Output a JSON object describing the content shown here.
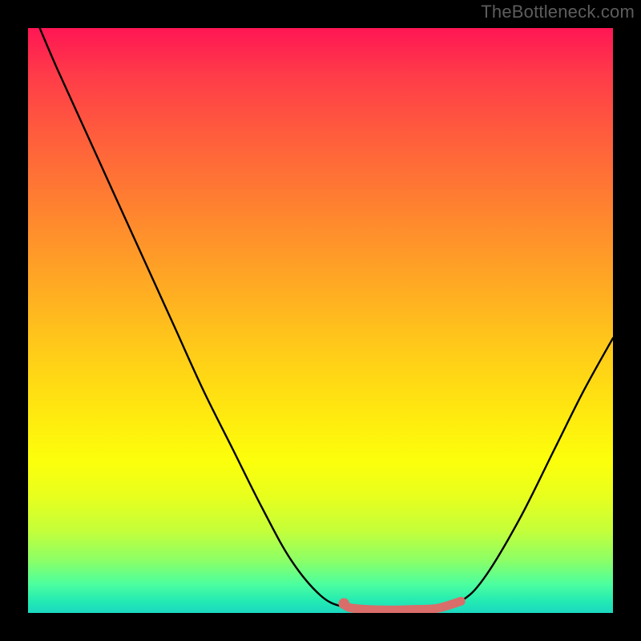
{
  "watermark": "TheBottleneck.com",
  "chart_data": {
    "type": "line",
    "title": "",
    "xlabel": "",
    "ylabel": "",
    "xlim": [
      0,
      100
    ],
    "ylim": [
      0,
      100
    ],
    "series": [
      {
        "name": "curve",
        "color": "#000000",
        "points": [
          {
            "x": 2,
            "y": 100
          },
          {
            "x": 5,
            "y": 93
          },
          {
            "x": 10,
            "y": 82
          },
          {
            "x": 15,
            "y": 71
          },
          {
            "x": 20,
            "y": 60
          },
          {
            "x": 25,
            "y": 49
          },
          {
            "x": 30,
            "y": 38
          },
          {
            "x": 35,
            "y": 28
          },
          {
            "x": 40,
            "y": 18
          },
          {
            "x": 45,
            "y": 9
          },
          {
            "x": 50,
            "y": 3
          },
          {
            "x": 54,
            "y": 1
          },
          {
            "x": 58,
            "y": 0.6
          },
          {
            "x": 62,
            "y": 0.5
          },
          {
            "x": 66,
            "y": 0.6
          },
          {
            "x": 70,
            "y": 0.8
          },
          {
            "x": 74,
            "y": 2
          },
          {
            "x": 78,
            "y": 6
          },
          {
            "x": 84,
            "y": 16
          },
          {
            "x": 90,
            "y": 28
          },
          {
            "x": 95,
            "y": 38
          },
          {
            "x": 100,
            "y": 47
          }
        ]
      },
      {
        "name": "highlight",
        "color": "#d96d6a",
        "points": [
          {
            "x": 54,
            "y": 1.6
          },
          {
            "x": 55,
            "y": 0.9
          },
          {
            "x": 58,
            "y": 0.6
          },
          {
            "x": 62,
            "y": 0.5
          },
          {
            "x": 66,
            "y": 0.6
          },
          {
            "x": 70,
            "y": 0.8
          },
          {
            "x": 74,
            "y": 2.0
          }
        ]
      }
    ],
    "marker": {
      "x": 54,
      "y": 1.6,
      "color": "#d96d6a"
    }
  }
}
